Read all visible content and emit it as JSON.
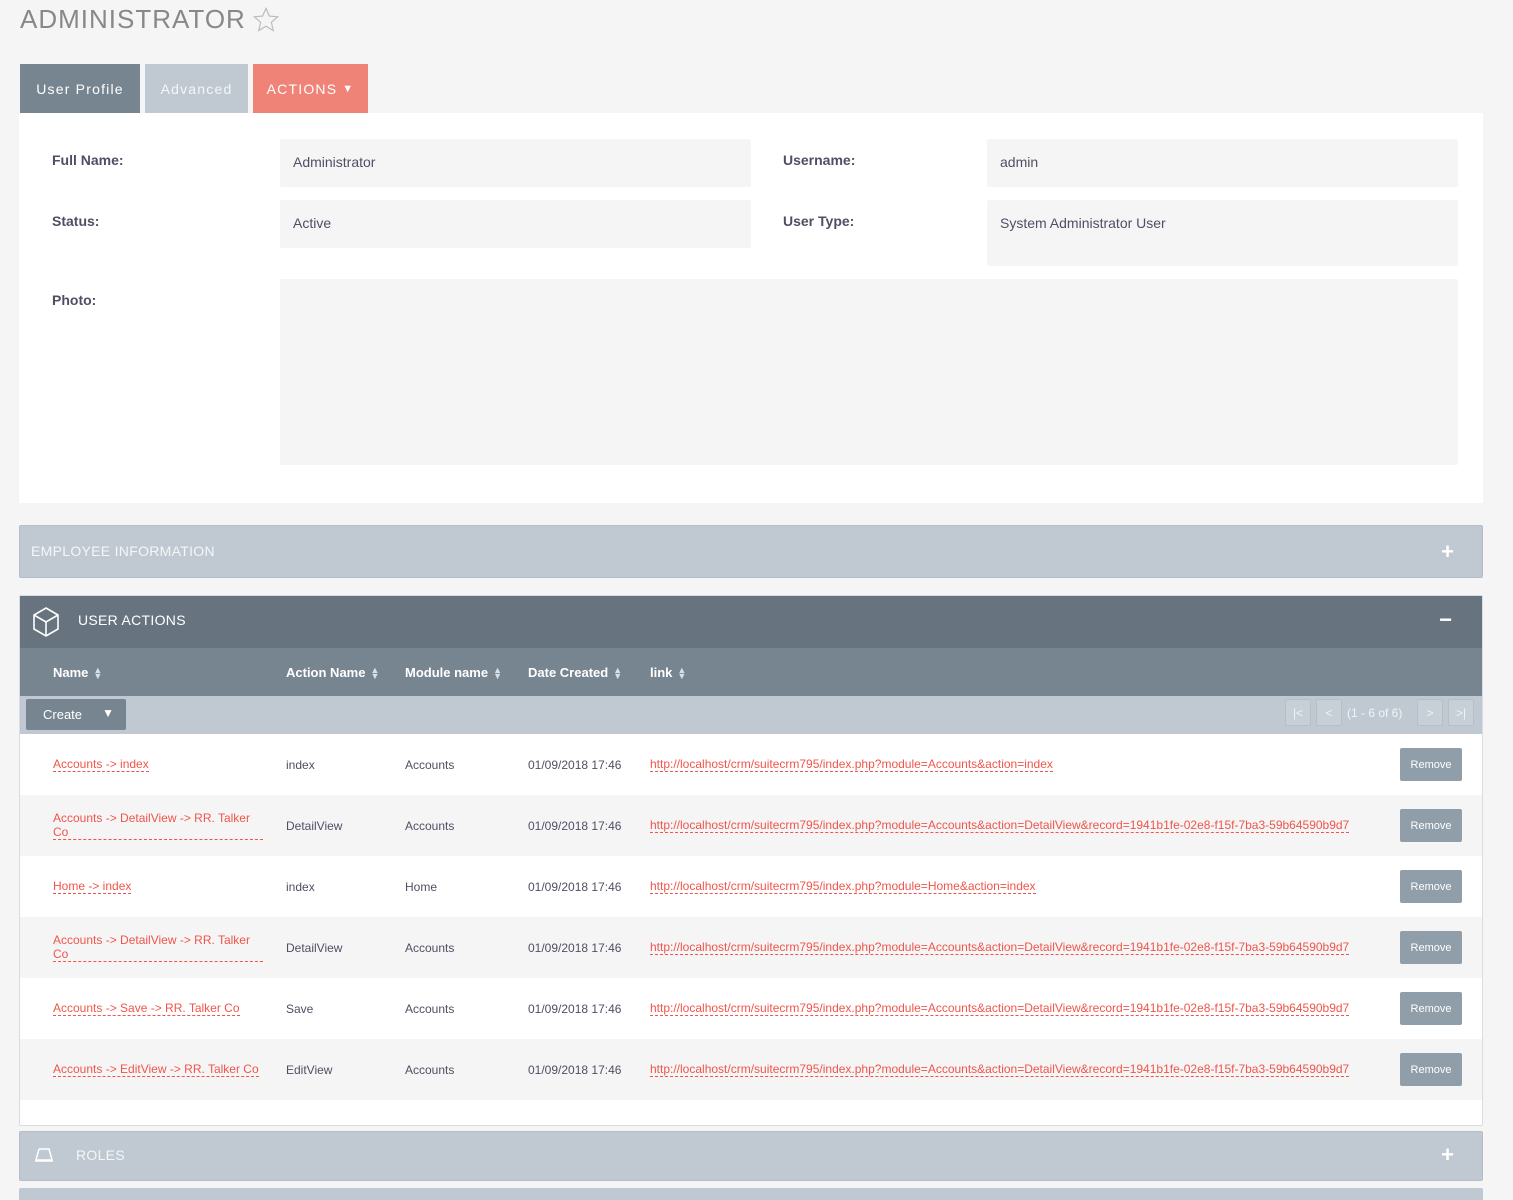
{
  "page": {
    "title": "ADMINISTRATOR"
  },
  "tabs": [
    {
      "label": "User Profile"
    },
    {
      "label": "Advanced"
    },
    {
      "label": "ACTIONS"
    }
  ],
  "profile": {
    "full_name_label": "Full Name:",
    "full_name_value": "Administrator",
    "username_label": "Username:",
    "username_value": "admin",
    "status_label": "Status:",
    "status_value": "Active",
    "user_type_label": "User Type:",
    "user_type_value": "System Administrator User",
    "photo_label": "Photo:"
  },
  "employee_info": {
    "title": "EMPLOYEE INFORMATION"
  },
  "user_actions": {
    "title": "USER ACTIONS",
    "columns": [
      "Name",
      "Action Name",
      "Module name",
      "Date Created",
      "link"
    ],
    "create_label": "Create",
    "pagination": {
      "first": "|<",
      "prev": "<",
      "text": "(1 - 6 of 6)",
      "next": ">",
      "last": ">|"
    },
    "remove_label": "Remove",
    "rows": [
      {
        "name": "Accounts -> index",
        "action": "index",
        "module": "Accounts",
        "date": "01/09/2018 17:46",
        "link": "http://localhost/crm/suitecrm795/index.php?module=Accounts&action=index"
      },
      {
        "name": "Accounts -> DetailView -> RR. Talker Co",
        "action": "DetailView",
        "module": "Accounts",
        "date": "01/09/2018 17:46",
        "link": "http://localhost/crm/suitecrm795/index.php?module=Accounts&action=DetailView&record=1941b1fe-02e8-f15f-7ba3-59b64590b9d7"
      },
      {
        "name": "Home -> index",
        "action": "index",
        "module": "Home",
        "date": "01/09/2018 17:46",
        "link": "http://localhost/crm/suitecrm795/index.php?module=Home&action=index"
      },
      {
        "name": "Accounts -> DetailView -> RR. Talker Co",
        "action": "DetailView",
        "module": "Accounts",
        "date": "01/09/2018 17:46",
        "link": "http://localhost/crm/suitecrm795/index.php?module=Accounts&action=DetailView&record=1941b1fe-02e8-f15f-7ba3-59b64590b9d7"
      },
      {
        "name": "Accounts -> Save -> RR. Talker Co",
        "action": "Save",
        "module": "Accounts",
        "date": "01/09/2018 17:46",
        "link": "http://localhost/crm/suitecrm795/index.php?module=Accounts&action=DetailView&record=1941b1fe-02e8-f15f-7ba3-59b64590b9d7"
      },
      {
        "name": "Accounts -> EditView -> RR. Talker Co",
        "action": "EditView",
        "module": "Accounts",
        "date": "01/09/2018 17:46",
        "link": "http://localhost/crm/suitecrm795/index.php?module=Accounts&action=DetailView&record=1941b1fe-02e8-f15f-7ba3-59b64590b9d7"
      }
    ]
  },
  "roles": {
    "title": "ROLES"
  },
  "colors": {
    "accent": "#f08377",
    "link": "#f0554b",
    "header": "#67747f",
    "subheader": "#778591",
    "collapsed": "#c0c9d2"
  }
}
